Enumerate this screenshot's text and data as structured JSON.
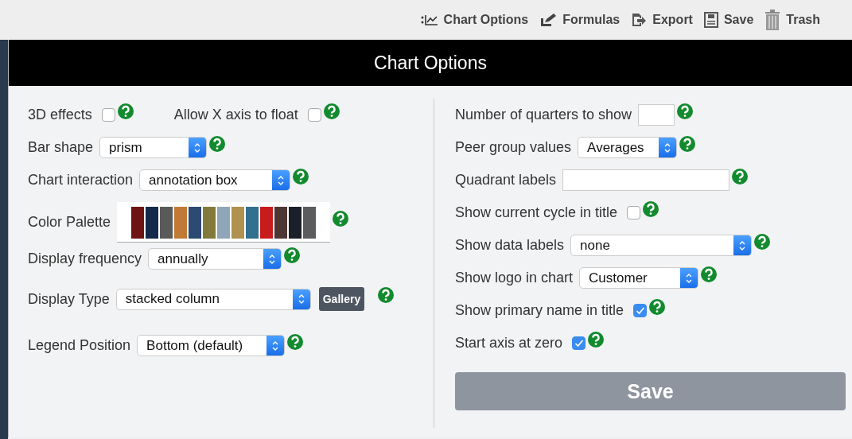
{
  "toolbar": [
    {
      "label": "Chart Options"
    },
    {
      "label": "Formulas"
    },
    {
      "label": "Export"
    },
    {
      "label": "Save"
    },
    {
      "label": "Trash"
    }
  ],
  "dialog": {
    "title": "Chart Options",
    "left": [
      {
        "fields": [
          {
            "kind": "checkbox",
            "label": "3D effects",
            "checked": false
          },
          {
            "kind": "checkbox",
            "label": "Allow X axis to float",
            "checked": false
          }
        ]
      },
      {
        "fields": [
          {
            "kind": "select",
            "label": "Bar shape",
            "value": "prism"
          }
        ]
      },
      {
        "fields": [
          {
            "kind": "select",
            "label": "Chart interaction",
            "value": "annotation box"
          }
        ]
      },
      {
        "fields": [
          {
            "kind": "palette",
            "label": "Color Palette",
            "colors": [
              {
                "color": "#6e1414"
              },
              {
                "color": "#15294a"
              },
              {
                "color": "#5a5a5a"
              },
              {
                "color": "#c07a35"
              },
              {
                "color": "#2c4a72"
              },
              {
                "color": "#817a3a"
              },
              {
                "color": "#8fa6b9"
              },
              {
                "color": "#b0914e"
              },
              {
                "color": "#336f8f"
              },
              {
                "color": "#c81c1c"
              },
              {
                "color": "#4e3634"
              },
              {
                "color": "#1b1f2a"
              },
              {
                "color": "#5b5c5e"
              }
            ]
          }
        ]
      },
      {
        "fields": [
          {
            "kind": "select",
            "label": "Display frequency",
            "value": "annually"
          }
        ]
      },
      {
        "fields": [
          {
            "kind": "select",
            "label": "Display Type",
            "value": "stacked column",
            "button": "Gallery"
          }
        ]
      },
      {
        "fields": [
          {
            "kind": "select",
            "label": "Legend Position",
            "value": "Bottom (default)"
          }
        ]
      }
    ],
    "right": [
      {
        "fields": [
          {
            "kind": "text",
            "label": "Number of quarters to show"
          }
        ]
      },
      {
        "fields": [
          {
            "kind": "select",
            "label": "Peer group values",
            "value": "Averages"
          }
        ]
      },
      {
        "fields": [
          {
            "kind": "text",
            "label": "Quadrant labels"
          }
        ]
      },
      {
        "fields": [
          {
            "kind": "checkbox",
            "label": "Show current cycle in title",
            "checked": false
          }
        ]
      },
      {
        "fields": [
          {
            "kind": "select",
            "label": "Show data labels",
            "value": "none"
          }
        ]
      },
      {
        "fields": [
          {
            "kind": "select",
            "label": "Show logo in chart",
            "value": "Customer"
          }
        ]
      },
      {
        "fields": [
          {
            "kind": "checkbox",
            "label": "Show primary name in title",
            "checked": true
          }
        ]
      },
      {
        "fields": [
          {
            "kind": "checkbox",
            "label": "Start axis at zero",
            "checked": true
          }
        ]
      }
    ],
    "save_button": "Save"
  }
}
